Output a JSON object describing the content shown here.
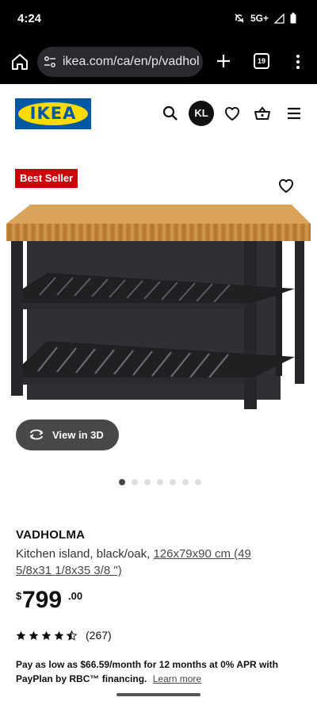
{
  "status_bar": {
    "time": "4:24",
    "network": "5G+",
    "icons": [
      "mute-icon",
      "signal-icon",
      "battery-icon"
    ]
  },
  "browser": {
    "url": "ikea.com/ca/en/p/vadhol",
    "tab_count": "19"
  },
  "header": {
    "logo_text": "IKEA",
    "avatar_initials": "KL",
    "icons": [
      "search-icon",
      "heart-icon",
      "basket-icon",
      "hamburger-menu-icon"
    ]
  },
  "product_image": {
    "badge": "Best Seller",
    "view_3d_label": "View in 3D",
    "carousel": {
      "total": 7,
      "active": 1
    }
  },
  "product": {
    "name": "VADHOLMA",
    "description": "Kitchen island, black/oak,",
    "dimensions": "126x79x90 cm (49 5/8x31 1/8x35 3/8 \")",
    "price_currency": "$",
    "price_whole": "799",
    "price_cents": ".00",
    "rating_stars": 4.5,
    "review_count": "(267)",
    "financing_text": "Pay as low as $66.59/month for 12 months at 0% APR with PayPlan by RBC™ financing.",
    "learn_more": "Learn more"
  },
  "colors": {
    "ikea_blue": "#0058a3",
    "ikea_yellow": "#ffdb00",
    "badge_red": "#cc0008"
  }
}
